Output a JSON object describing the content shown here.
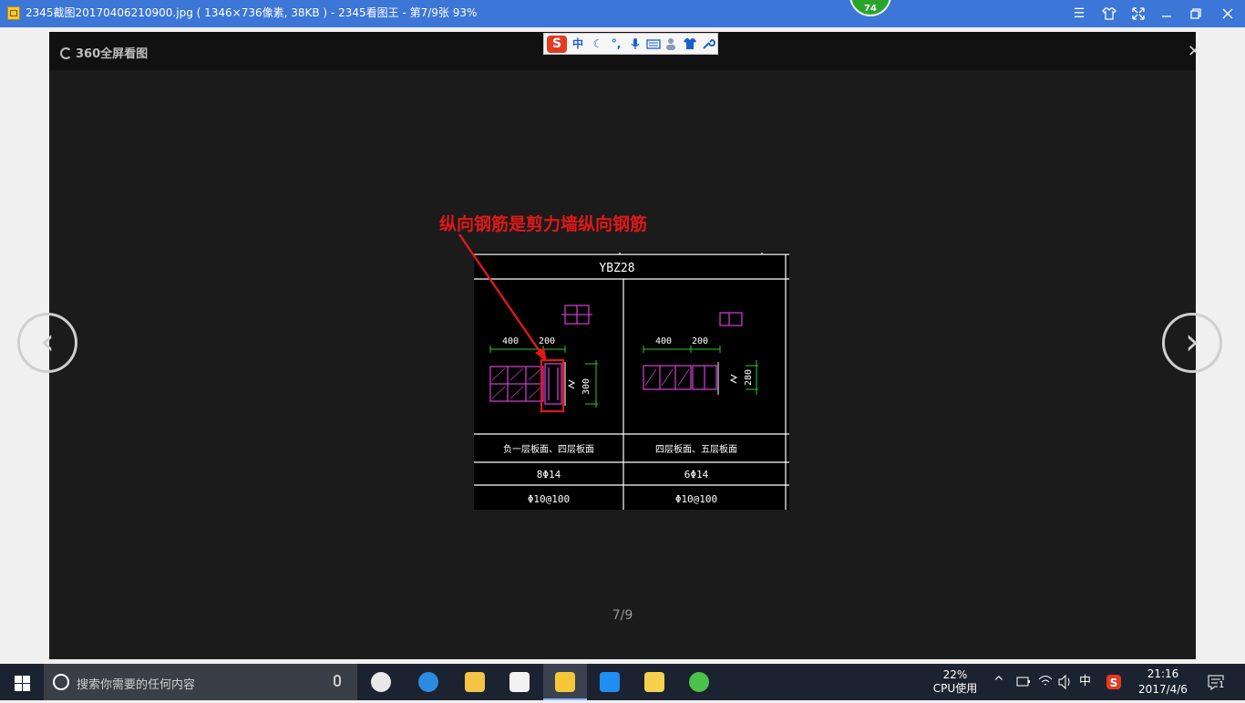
{
  "window": {
    "title": "2345截图20170406210900.jpg ( 1346×736像素, 38KB ) - 2345看图王 - 第7/9张 93%",
    "badge": "74",
    "controls": [
      "menu-icon",
      "skin-icon",
      "fullscreen-icon",
      "minimize-icon",
      "restore-icon",
      "close-icon"
    ]
  },
  "viewer": {
    "brand": "360全屏看图",
    "close_glyph": "×",
    "prev_glyph": "‹",
    "next_glyph": "›",
    "counter": "7/9"
  },
  "ime": {
    "logo": "S",
    "mode": "中",
    "items": [
      "moon-icon",
      "punct-icon",
      "mic-icon",
      "keyboard-icon",
      "user-icon",
      "shirt-icon",
      "wrench-icon"
    ]
  },
  "image": {
    "annotation": "纵向钢筋是剪力墙纵向钢筋",
    "annotation_color": "#e01818",
    "drawing": {
      "title": "YBZ28",
      "left_dims": [
        "400",
        "200",
        "300"
      ],
      "right_dims": [
        "400",
        "200",
        "280"
      ],
      "rows": [
        [
          "负一层板面、四层板面",
          "四层板面、五层板面"
        ],
        [
          "8Φ14",
          "6Φ14"
        ],
        [
          "Φ10@100",
          "Φ10@100"
        ]
      ],
      "line_color": "#ffffff",
      "section_color": "#c83cc8",
      "dim_color": "#2cc92c",
      "highlight_color": "#e01818"
    }
  },
  "taskbar": {
    "search_placeholder": "搜索你需要的任何内容",
    "apps": [
      "baidu-app",
      "ie-browser",
      "file-explorer",
      "store",
      "2345-viewer",
      "tool-app",
      "notes-app",
      "browser-360"
    ],
    "cpu_percent": "22%",
    "cpu_label": "CPU使用",
    "ime_indicator": "中",
    "time": "21:16",
    "date": "2017/4/6",
    "notification_count": "1"
  }
}
